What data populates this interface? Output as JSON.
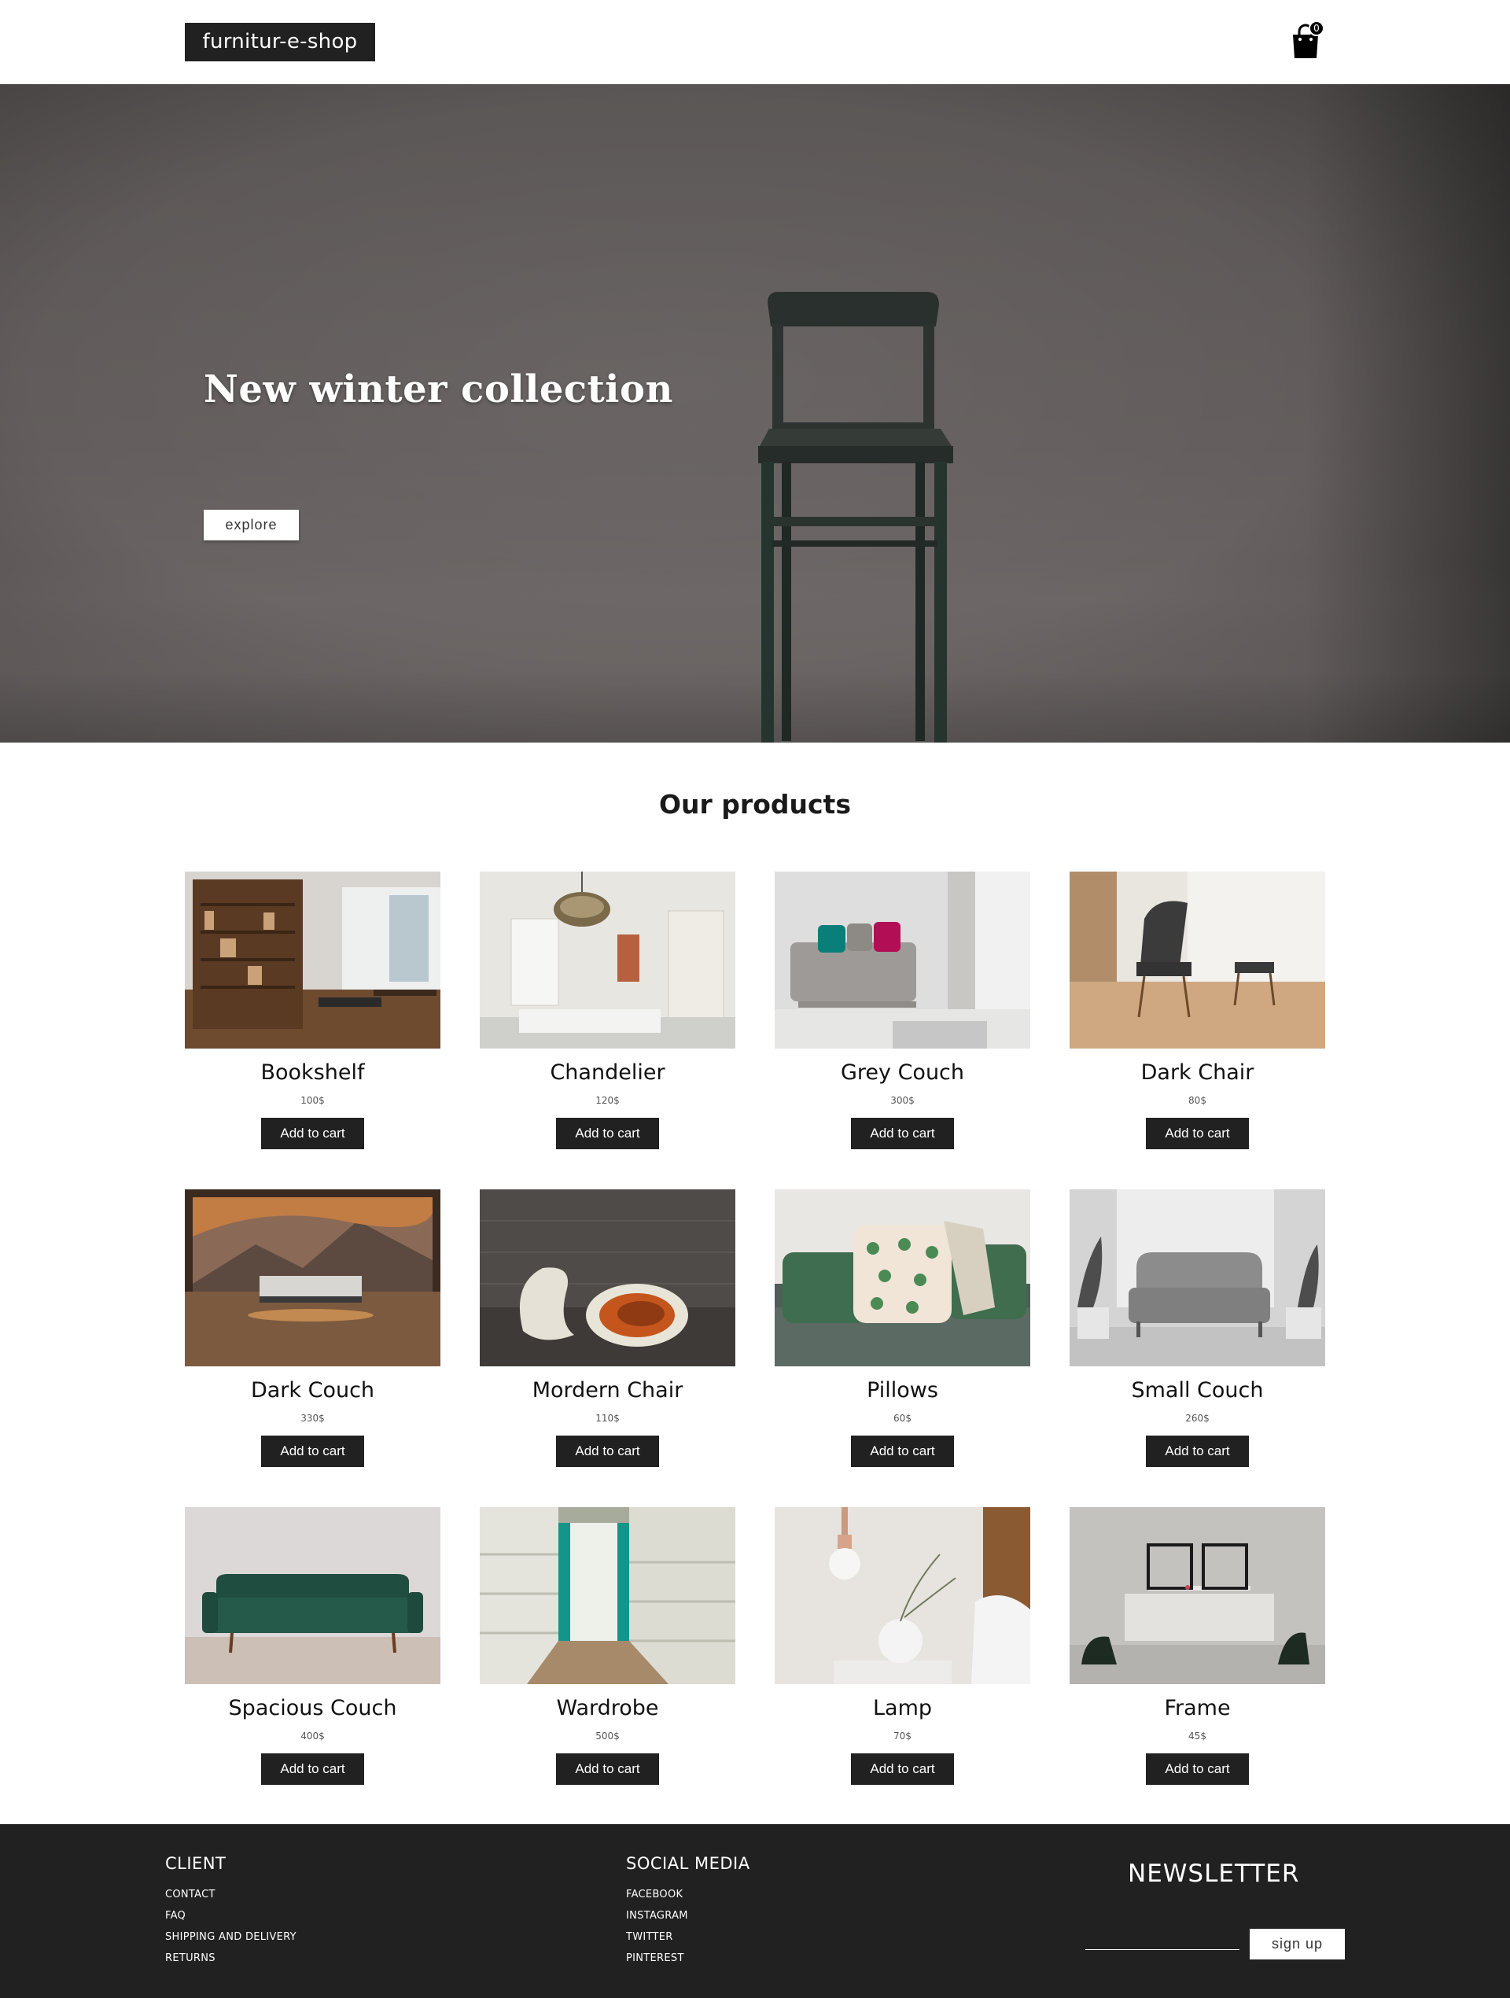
{
  "header": {
    "logo": "furnitur-e-shop",
    "cart_icon": "shopping-bag-icon",
    "cart_count": "0"
  },
  "hero": {
    "title": "New winter collection",
    "button_label": "explore"
  },
  "products_section": {
    "title": "Our products",
    "add_label": "Add to cart",
    "items": [
      {
        "name": "Bookshelf",
        "price": "100$"
      },
      {
        "name": "Chandelier",
        "price": "120$"
      },
      {
        "name": "Grey Couch",
        "price": "300$"
      },
      {
        "name": "Dark Chair",
        "price": "80$"
      },
      {
        "name": "Dark Couch",
        "price": "330$"
      },
      {
        "name": "Mordern Chair",
        "price": "110$"
      },
      {
        "name": "Pillows",
        "price": "60$"
      },
      {
        "name": "Small Couch",
        "price": "260$"
      },
      {
        "name": "Spacious Couch",
        "price": "400$"
      },
      {
        "name": "Wardrobe",
        "price": "500$"
      },
      {
        "name": "Lamp",
        "price": "70$"
      },
      {
        "name": "Frame",
        "price": "45$"
      }
    ]
  },
  "footer": {
    "client": {
      "heading": "CLIENT",
      "links": [
        "CONTACT",
        "FAQ",
        "SHIPPING AND DELIVERY",
        "RETURNS"
      ]
    },
    "social": {
      "heading": "SOCIAL MEDIA",
      "links": [
        "FACEBOOK",
        "INSTAGRAM",
        "TWITTER",
        "PINTEREST"
      ]
    },
    "newsletter": {
      "heading": "NEWSLETTER",
      "button_label": "sign up"
    }
  }
}
